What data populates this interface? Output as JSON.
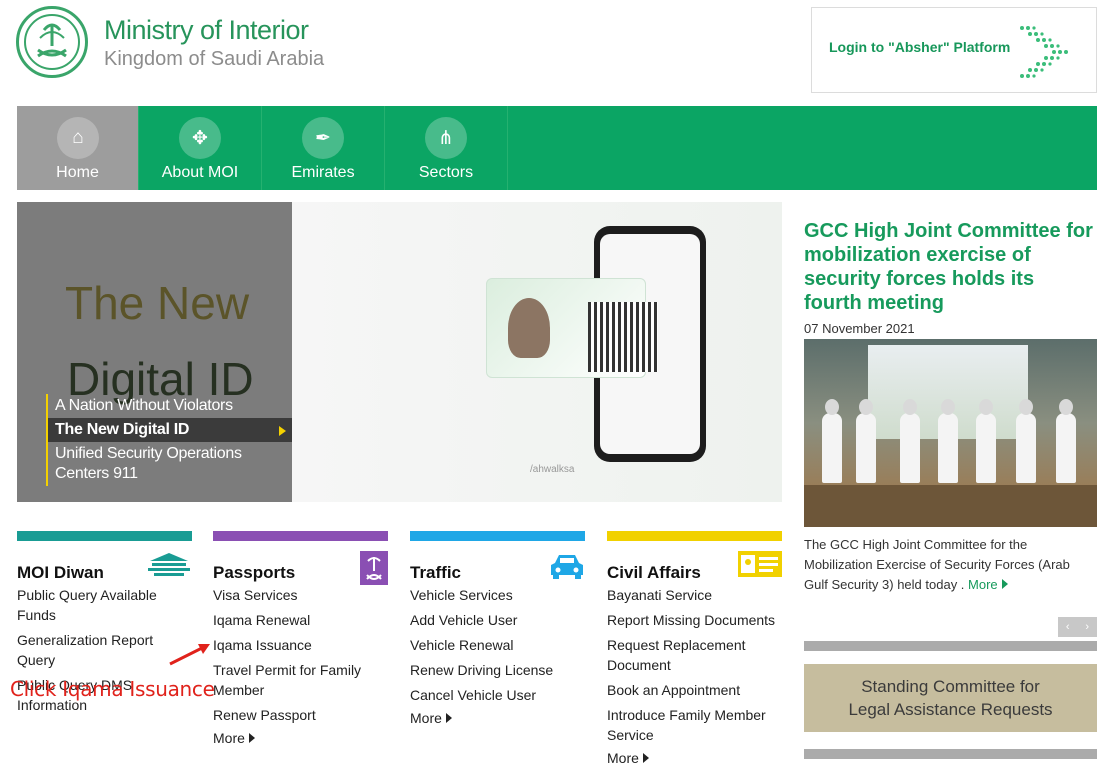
{
  "header": {
    "brand_title": "Ministry of Interior",
    "brand_subtitle": "Kingdom of Saudi Arabia",
    "absher_label": "Login to \"Absher\" Platform"
  },
  "nav": {
    "items": [
      {
        "label": "Home",
        "icon": "home-icon",
        "active": true
      },
      {
        "label": "About MOI",
        "icon": "emblem-icon"
      },
      {
        "label": "Emirates",
        "icon": "calligraphy-icon"
      },
      {
        "label": "Sectors",
        "icon": "share-icon"
      }
    ]
  },
  "hero": {
    "headline_1": "The New",
    "headline_2": "Digital ID",
    "footer_text": "/ahwalksa",
    "menu": [
      {
        "label": "A Nation Without Violators"
      },
      {
        "label": "The New Digital ID",
        "selected": true
      },
      {
        "label": "Unified Security Operations Centers 911"
      }
    ]
  },
  "news": {
    "title": "GCC High Joint Committee for mobilization exercise of security forces holds its fourth meeting",
    "date": "07 November 2021",
    "body": "The GCC High Joint Committee for the Mobilization Exercise of Security Forces (Arab Gulf Security 3) held today .",
    "more_label": "More",
    "pager_prev": "‹",
    "pager_next": "›"
  },
  "banner": {
    "line_1": "Standing Committee for",
    "line_2": "Legal Assistance Requests"
  },
  "columns": [
    {
      "title": "MOI Diwan",
      "color": "#199c94",
      "icon": "diwan-building-icon",
      "links": [
        "Public Query Available Funds",
        "Generalization Report Query",
        "Public Query DMS Information"
      ],
      "more_label": null
    },
    {
      "title": "Passports",
      "color": "#8a4fb3",
      "icon": "passport-emblem-icon",
      "links": [
        "Visa Services",
        "Iqama Renewal",
        "Iqama Issuance",
        "Travel Permit for Family Member",
        "Renew Passport"
      ],
      "more_label": "More"
    },
    {
      "title": "Traffic",
      "color": "#1fa7e6",
      "icon": "car-icon",
      "links": [
        "Vehicle Services",
        "Add Vehicle User",
        "Vehicle Renewal",
        "Renew Driving License",
        "Cancel Vehicle User"
      ],
      "more_label": "More"
    },
    {
      "title": "Civil Affairs",
      "color": "#f1d100",
      "icon": "id-card-icon",
      "links": [
        "Bayanati Service",
        "Report Missing Documents",
        "Request Replacement Document",
        "Book an Appointment",
        "Introduce Family Member Service"
      ],
      "more_label": "More"
    }
  ],
  "annotation": {
    "text": "Click Iqama Issuance"
  },
  "colors": {
    "brand_green": "#0ba564",
    "nav_active": "#9d9d9d",
    "annotation_red": "#e0221b"
  }
}
